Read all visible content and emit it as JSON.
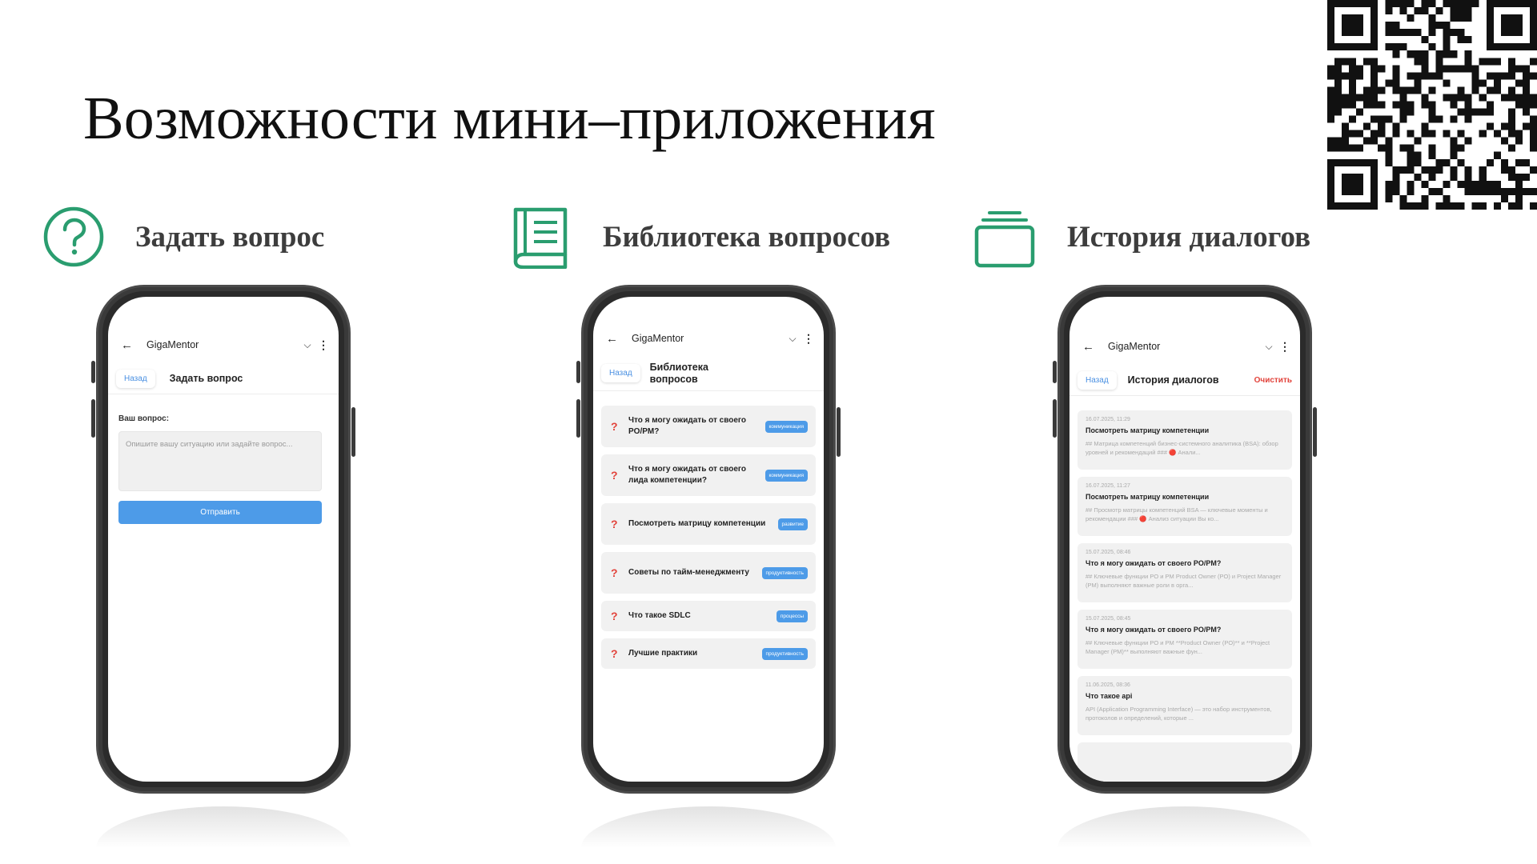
{
  "slide": {
    "title": "Возможности мини–приложения"
  },
  "colors": {
    "accent_green": "#2a9d6f",
    "primary_blue": "#4d9be8",
    "danger_red": "#e2433b"
  },
  "features": [
    {
      "title": "Задать вопрос",
      "icon": "question-circle-icon"
    },
    {
      "title": "Библиотека вопросов",
      "icon": "book-icon"
    },
    {
      "title": "История диалогов",
      "icon": "stack-icon"
    }
  ],
  "phones": {
    "ask": {
      "app_name": "GigaMentor",
      "back_chip": "Назад",
      "screen_title": "Задать вопрос",
      "field_label": "Ваш вопрос:",
      "placeholder": "Опишите вашу ситуацию или задайте вопрос...",
      "send_label": "Отправить"
    },
    "library": {
      "app_name": "GigaMentor",
      "back_chip": "Назад",
      "screen_title": "Библиотека вопросов",
      "items": [
        {
          "text": "Что я могу ожидать от своего PO/PM?",
          "tag": "коммуникация"
        },
        {
          "text": "Что я могу ожидать от своего лида компетенции?",
          "tag": "коммуникация"
        },
        {
          "text": "Посмотреть матрицу компетенции",
          "tag": "развитие"
        },
        {
          "text": "Советы по тайм-менеджменту",
          "tag": "продуктивность"
        },
        {
          "text": "Что такое SDLC",
          "tag": "процессы"
        },
        {
          "text": "Лучшие практики",
          "tag": "продуктивность"
        }
      ]
    },
    "history": {
      "app_name": "GigaMentor",
      "back_chip": "Назад",
      "screen_title": "История диалогов",
      "clear_label": "Очистить",
      "items": [
        {
          "date": "16.07.2025, 11:29",
          "title": "Посмотреть матрицу компетенции",
          "snippet": "## Матрица компетенций бизнес-системного аналитика (BSA): обзор уровней и рекомендаций ### 🔴 Анали..."
        },
        {
          "date": "16.07.2025, 11:27",
          "title": "Посмотреть матрицу компетенции",
          "snippet": "## Просмотр матрицы компетенций BSA — ключевые моменты и рекомендации ### 🔴 Анализ ситуации Вы ко..."
        },
        {
          "date": "15.07.2025, 08:46",
          "title": "Что я могу ожидать от своего PO/PM?",
          "snippet": "## Ключевые функции PO и PM Product Owner (PO) и Project Manager (PM) выполняют важные роли в орга..."
        },
        {
          "date": "15.07.2025, 08:45",
          "title": "Что я могу ожидать от своего PO/PM?",
          "snippet": "## Ключевые функции PO и PM **Product Owner (PO)** и **Project Manager (PM)** выполняют важные фун..."
        },
        {
          "date": "11.06.2025, 08:36",
          "title": "Что такое api",
          "snippet": "API (Application Programming Interface) — это набор инструментов, протоколов и определений, которые ..."
        }
      ]
    }
  }
}
